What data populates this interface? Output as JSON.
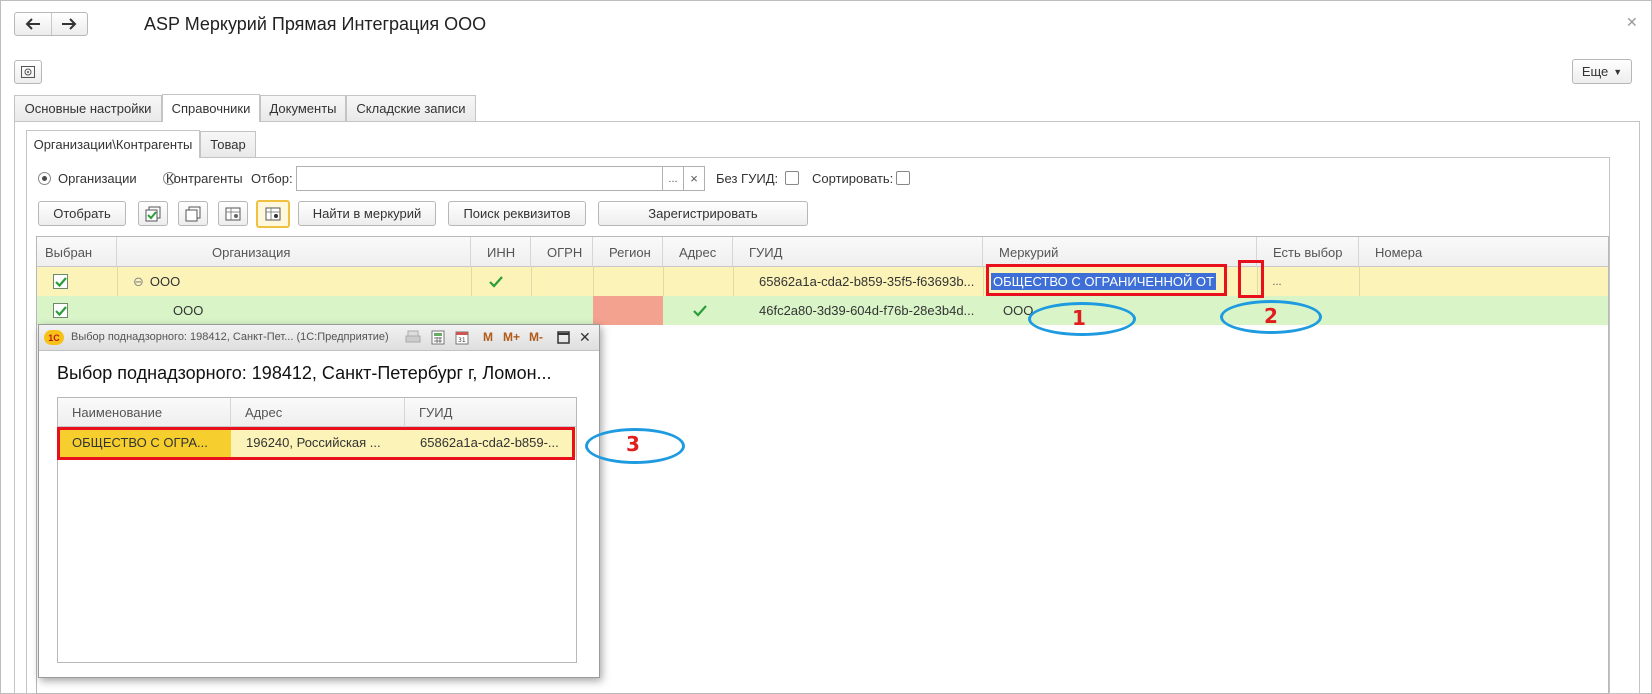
{
  "window": {
    "title": "ASP Меркурий Прямая Интеграция ООО"
  },
  "toolbar": {
    "more_label": "Еще"
  },
  "tabs": [
    {
      "label": "Основные настройки"
    },
    {
      "label": "Справочники"
    },
    {
      "label": "Документы"
    },
    {
      "label": "Складские записи"
    }
  ],
  "subtabs": [
    {
      "label": "Организации\\Контрагенты"
    },
    {
      "label": "Товар"
    }
  ],
  "filter": {
    "radio_org": "Организации",
    "radio_contr": "Контрагенты",
    "selected": "Организации",
    "filter_label": "Отбор:",
    "filter_value": "",
    "browse_glyph": "...",
    "clear_glyph": "×",
    "no_guid_label": "Без ГУИД:",
    "sort_label": "Сортировать:"
  },
  "actions": {
    "select_label": "Отобрать",
    "find_label": "Найти в меркурий",
    "search_label": "Поиск реквизитов",
    "register_label": "Зарегистрировать"
  },
  "grid": {
    "columns": [
      "Выбран",
      "Организация",
      "ИНН",
      "ОГРН",
      "Регион",
      "Адрес",
      "ГУИД",
      "Меркурий",
      "Есть выбор",
      "Номера"
    ],
    "rows": [
      {
        "selected": true,
        "collapse_glyph": "⊖",
        "organization": "ООО",
        "inn_ok": true,
        "guid": "65862a1a-cda2-b859-35f5-f63693b...",
        "mercury": "ОБЩЕСТВО С ОГРАНИЧЕННОЙ ОТ",
        "choice_glyph": "...",
        "highlight": "#fbf3b8"
      },
      {
        "selected": true,
        "organization": "ООО",
        "address_ok": true,
        "guid": "46fc2a80-3d39-604d-f76b-28e3b4d...",
        "mercury": "ООО",
        "highlight": "#d9f5c8",
        "region_color": "#f3a28f"
      }
    ]
  },
  "dialog": {
    "title": "Выбор поднадзорного: 198412, Санкт-Пет... (1С:Предприятие)",
    "logo": "1С",
    "heading": "Выбор поднадзорного: 198412, Санкт-Петербург г, Ломон...",
    "tools": {
      "m": "M",
      "mplus": "M+",
      "mminus": "M-"
    },
    "columns": [
      "Наименование",
      "Адрес",
      "ГУИД"
    ],
    "rows": [
      {
        "name": "ОБЩЕСТВО С ОГРА...",
        "address": "196240, Российская ...",
        "guid": "65862a1a-cda2-b859-..."
      }
    ]
  },
  "annotations": [
    {
      "label": "1"
    },
    {
      "label": "2"
    },
    {
      "label": "3"
    }
  ],
  "colors": {
    "accent_red": "#e8101c",
    "accent_blue": "#1e9be0",
    "check_green": "#2a9d3a"
  }
}
